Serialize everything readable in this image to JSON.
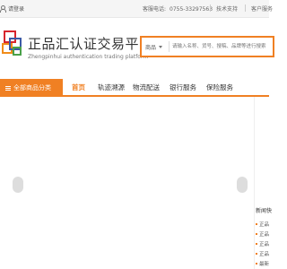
{
  "topbar": {
    "login": "请登录",
    "hotline_label": "客服电话:",
    "hotline_number": "0755-33297563",
    "tech_support": "技术支持",
    "customer_service": "客户服务"
  },
  "header": {
    "brand_title": "正品汇认证交易平台",
    "brand_sub": "Zhengpinhui authentication trading platform",
    "search_category": "商品",
    "search_placeholder": "请输入名称、货号、搜稿、品牌等进行搜索"
  },
  "nav": {
    "all_categories": "全部商品分类",
    "items": [
      "首页",
      "轨迹溯源",
      "物流配送",
      "银行服务",
      "保险服务"
    ]
  },
  "news": {
    "title": "新闻快",
    "items": [
      "正品",
      "正品",
      "正品",
      "正品",
      "最新"
    ]
  },
  "colors": {
    "accent": "#f08023"
  }
}
